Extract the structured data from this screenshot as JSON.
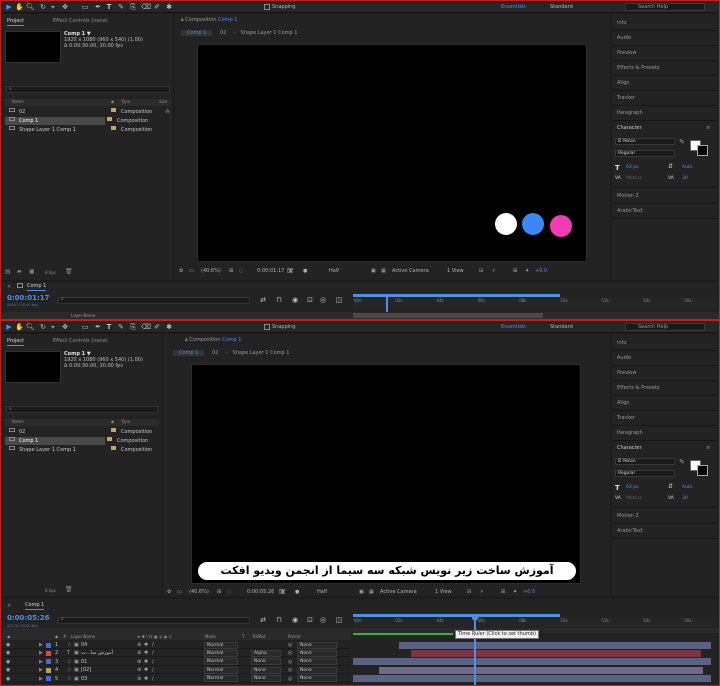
{
  "colors": {
    "accent": "#4f8fe8",
    "circle1": "#ffffff",
    "circle2": "#3d87f5",
    "circle3": "#f23cb4",
    "layer_bar_blue": "#5a6384",
    "layer_bar_red": "#7b3741",
    "layer_bar_lav": "#6f6a8a"
  },
  "toolbar": {
    "snapping": "Snapping",
    "ws_essentials": "Essentials",
    "ws_standard": "Standard",
    "search_help": "Search Help"
  },
  "project": {
    "tab_project": "Project",
    "tab_effect_controls": "Effect Controls (none)",
    "comp_name": "Comp 1 ▼",
    "comp_size": "1920 x 1080  (960 x 540) (1.00)",
    "comp_duration": "Δ 0:00:30:00, 30.00 fps",
    "col_name": "Name",
    "col_type": "Type",
    "col_size": "Size",
    "items": [
      {
        "name": "02",
        "type": "Composition"
      },
      {
        "name": "Comp 1",
        "type": "Composition"
      },
      {
        "name": "Shape Layer 1 Comp 1",
        "type": "Composition"
      }
    ],
    "bpc": "8 bpc"
  },
  "comp_panel": {
    "title": "Composition Comp 1",
    "title_prefix": "Composition",
    "title_comp": "Comp 1",
    "crumbs": [
      "Comp 1",
      "02",
      "Shape Layer 1 Comp 1"
    ]
  },
  "viewer_bar_top": {
    "zoom": "(40.6%)",
    "time": "0:00:01:17",
    "res": "Half",
    "camera": "Active Camera",
    "views": "1 View",
    "exposure": "+0.0"
  },
  "viewer_bar_bot": {
    "zoom": "(40.6%)",
    "time": "0:00:05:26",
    "res": "Half",
    "camera": "Active Camera",
    "views": "1 View",
    "exposure": "+0.0"
  },
  "right_panel": {
    "items_top": [
      "Info",
      "Audio",
      "Preview",
      "Effects & Presets",
      "Align",
      "Tracker",
      "Paragraph"
    ],
    "character": "Character",
    "font": "B Yekan",
    "style": "Regular",
    "size": "63 px",
    "leading": "Auto",
    "kerning": "Metrics",
    "tracking": "30",
    "items_bottom": [
      "Motion 2",
      "ArabicText"
    ]
  },
  "timeline_top": {
    "tab": "Comp 1",
    "timecode": "0:00:01:17",
    "sub": "00047 (30.00 fps)",
    "ticks": [
      "00s",
      "02s",
      "04s",
      "06s",
      "08s",
      "10s",
      "12s",
      "14s",
      "16s"
    ],
    "col_layer_name": "Layer Name"
  },
  "timeline_bot": {
    "tab": "Comp 1",
    "timecode": "0:00:05:26",
    "sub": "00176 (30.00 fps)",
    "ticks": [
      "00s",
      "02s",
      "04s",
      "06s",
      "08s",
      "10s",
      "12s",
      "14s",
      "16s"
    ],
    "headers": {
      "layer_name": "Layer Name",
      "mode": "Mode",
      "t": "T",
      "trkmat": "TrkMat",
      "parent": "Parent"
    },
    "tooltip": "Time Ruler (Click to set thumb)",
    "layers": [
      {
        "num": "1",
        "name": "04",
        "mode": "Normal",
        "trkmat": "",
        "parent": "None",
        "color": "#4c66d6",
        "bar": "#5a6384"
      },
      {
        "num": "2",
        "name": "آموزش سا...ت",
        "mode": "Normal",
        "trkmat": "Alpha",
        "parent": "None",
        "color": "#d14c4c",
        "bar": "#7b3741"
      },
      {
        "num": "3",
        "name": "01",
        "mode": "Normal",
        "trkmat": "None",
        "parent": "None",
        "color": "#4c66d6",
        "bar": "#5a6384"
      },
      {
        "num": "4",
        "name": "[02]",
        "mode": "Normal",
        "trkmat": "None",
        "parent": "None",
        "color": "#b2a36b",
        "bar": "#6f6a8a"
      },
      {
        "num": "5",
        "name": "03",
        "mode": "Normal",
        "trkmat": "None",
        "parent": "None",
        "color": "#4c66d6",
        "bar": "#5a6384"
      }
    ]
  },
  "subtitle": "آموزش ساخت زیر نویس شبکه سه سیما از انجمن ویدیو افکت"
}
